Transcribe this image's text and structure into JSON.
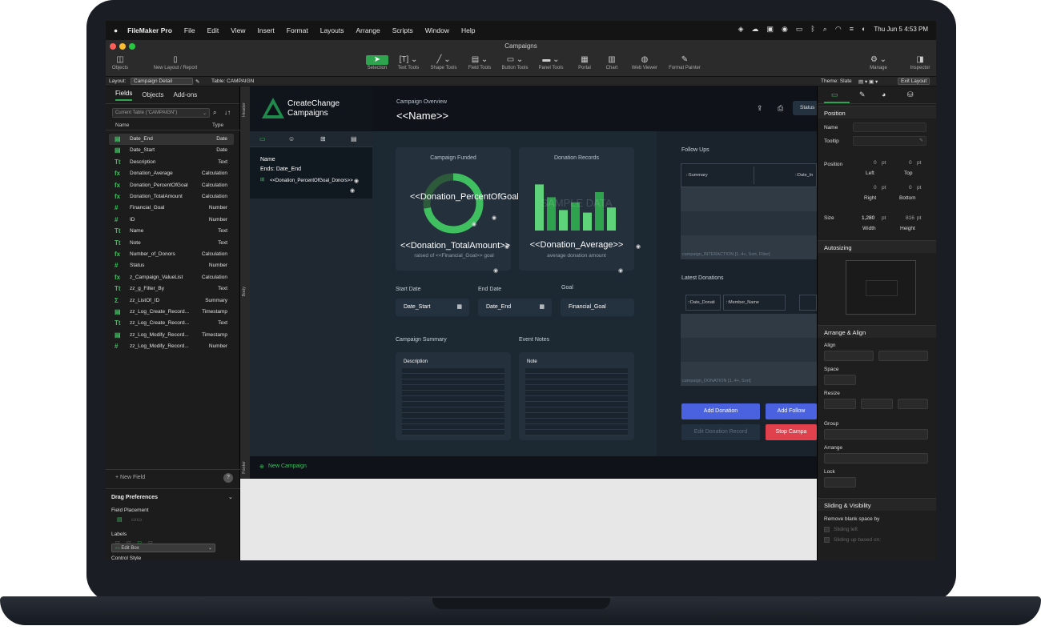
{
  "menubar": {
    "app": "FileMaker Pro",
    "items": [
      "File",
      "Edit",
      "View",
      "Insert",
      "Format",
      "Layouts",
      "Arrange",
      "Scripts",
      "Window",
      "Help"
    ],
    "clock": "Thu Jun 5  4:53 PM"
  },
  "window": {
    "title": "Campaigns"
  },
  "toolbar": {
    "objects": "Objects",
    "new_layout": "New Layout / Report",
    "selection": "Selection",
    "text_tools": "Text Tools",
    "shape_tools": "Shape Tools",
    "field_tools": "Field Tools",
    "button_tools": "Button Tools",
    "panel_tools": "Panel Tools",
    "portal": "Portal",
    "chart": "Chart",
    "web_viewer": "Web Viewer",
    "format_painter": "Format Painter",
    "manage": "Manage",
    "inspector": "Inspector"
  },
  "layoutbar": {
    "layout_label": "Layout:",
    "layout_value": "Campaign Detail",
    "table": "Table: CAMPAIGN",
    "theme": "Theme: Slate",
    "exit": "Exit Layout"
  },
  "leftpanel": {
    "tabs": [
      "Fields",
      "Objects",
      "Add-ons"
    ],
    "table_select": "Current Table (\"CAMPAIGN\")",
    "col_name": "Name",
    "col_type": "Type",
    "fields": [
      {
        "icon": "▤",
        "name": "Date_End",
        "type": "Date"
      },
      {
        "icon": "▤",
        "name": "Date_Start",
        "type": "Date"
      },
      {
        "icon": "Tt",
        "name": "Description",
        "type": "Text"
      },
      {
        "icon": "fx",
        "name": "Donation_Average",
        "type": "Calculation"
      },
      {
        "icon": "fx",
        "name": "Donation_PercentOfGoal",
        "type": "Calculation"
      },
      {
        "icon": "fx",
        "name": "Donation_TotalAmount",
        "type": "Calculation"
      },
      {
        "icon": "#",
        "name": "Financial_Goal",
        "type": "Number"
      },
      {
        "icon": "#",
        "name": "ID",
        "type": "Number"
      },
      {
        "icon": "Tt",
        "name": "Name",
        "type": "Text"
      },
      {
        "icon": "Tt",
        "name": "Note",
        "type": "Text"
      },
      {
        "icon": "fx",
        "name": "Number_of_Donors",
        "type": "Calculation"
      },
      {
        "icon": "#",
        "name": "Status",
        "type": "Number"
      },
      {
        "icon": "fx",
        "name": "z_Campaign_ValueList",
        "type": "Calculation"
      },
      {
        "icon": "Tt",
        "name": "zz_g_Filter_By",
        "type": "Text"
      },
      {
        "icon": "Σ",
        "name": "zz_ListOf_ID",
        "type": "Summary"
      },
      {
        "icon": "▤",
        "name": "zz_Log_Create_Record...",
        "type": "Timestamp"
      },
      {
        "icon": "Tt",
        "name": "zz_Log_Create_Record...",
        "type": "Text"
      },
      {
        "icon": "▤",
        "name": "zz_Log_Modify_Record...",
        "type": "Timestamp"
      },
      {
        "icon": "#",
        "name": "zz_Log_Modify_Record...",
        "type": "Number"
      }
    ],
    "new_field": "+ New Field",
    "drag_prefs": "Drag Preferences",
    "field_placement": "Field Placement",
    "labels": "Labels",
    "control_style": "Control Style",
    "edit_box": "Edit Box"
  },
  "layout": {
    "logo_line1": "CreateChange",
    "logo_line2": "Campaigns",
    "overview": "Campaign Overview",
    "name": "<<Name>>",
    "status": "Status",
    "portal_name": "Name",
    "portal_ends": "Ends:  Date_End",
    "portal_merge": "<<Donation_PercentOfGoal_Donors>>",
    "card1_title": "Campaign Funded",
    "donut_value": 0.72,
    "donut_text": "<<Donation_PercentOfGoal>>",
    "total": "<<Donation_TotalAmount>>",
    "raised": "raised of <<Financial_Goal>> goal",
    "card2_title": "Donation Records",
    "bars": [
      0.9,
      0.65,
      0.4,
      0.55,
      0.35,
      0.75,
      0.45
    ],
    "sample": "SAMPLE DATA",
    "average": "<<Donation_Average>>",
    "average_sub": "average donation amount",
    "start_label": "Start Date",
    "start_value": "Date_Start",
    "end_label": "End Date",
    "end_value": "Date_End",
    "goal_label": "Goal",
    "goal_value": "Financial_Goal",
    "summary_label": "Campaign Summary",
    "summary_field": "Description",
    "notes_label": "Event Notes",
    "notes_field": "Note",
    "followups": "Follow Ups",
    "fu_col1": "::Summary",
    "fu_col2": "::Date_In",
    "fu_portal": "campaign_INTERACTION [1..4+, Sort, Filter]",
    "latest": "Latest Donations",
    "ld_col1": "::Date_Donati",
    "ld_col2": "::Member_Name",
    "ld_portal": "campaign_DONATION [1..4+, Sort]",
    "add_donation": "Add Donation",
    "add_follow": "Add Follow",
    "edit_donation": "Edit Donation Record",
    "stop": "Stop Campa",
    "new_campaign": "New Campaign"
  },
  "bands": {
    "header": "Header",
    "body": "Body",
    "footer": "Footer"
  },
  "inspector": {
    "position": "Position",
    "name": "Name",
    "tooltip": "Tooltip",
    "position_lbl": "Position",
    "left_v": "0",
    "right_v": "0",
    "top_v": "0",
    "bottom_v": "0",
    "pt": "pt",
    "left": "Left",
    "top": "Top",
    "right": "Right",
    "bottom": "Bottom",
    "size": "Size",
    "width_v": "1,280",
    "height_v": "816",
    "width": "Width",
    "height": "Height",
    "autosizing": "Autosizing",
    "arrange_align": "Arrange & Align",
    "align": "Align",
    "space": "Space",
    "resize": "Resize",
    "group": "Group",
    "arrange": "Arrange",
    "lock": "Lock",
    "sliding": "Sliding & Visibility",
    "remove_blank": "Remove blank space by",
    "sliding_left": "Sliding left",
    "sliding_up": "Sliding up based on:"
  },
  "colors": {
    "accent_green": "#2ea44f",
    "blue_button": "#4a62e0",
    "red_button": "#e0414d"
  }
}
